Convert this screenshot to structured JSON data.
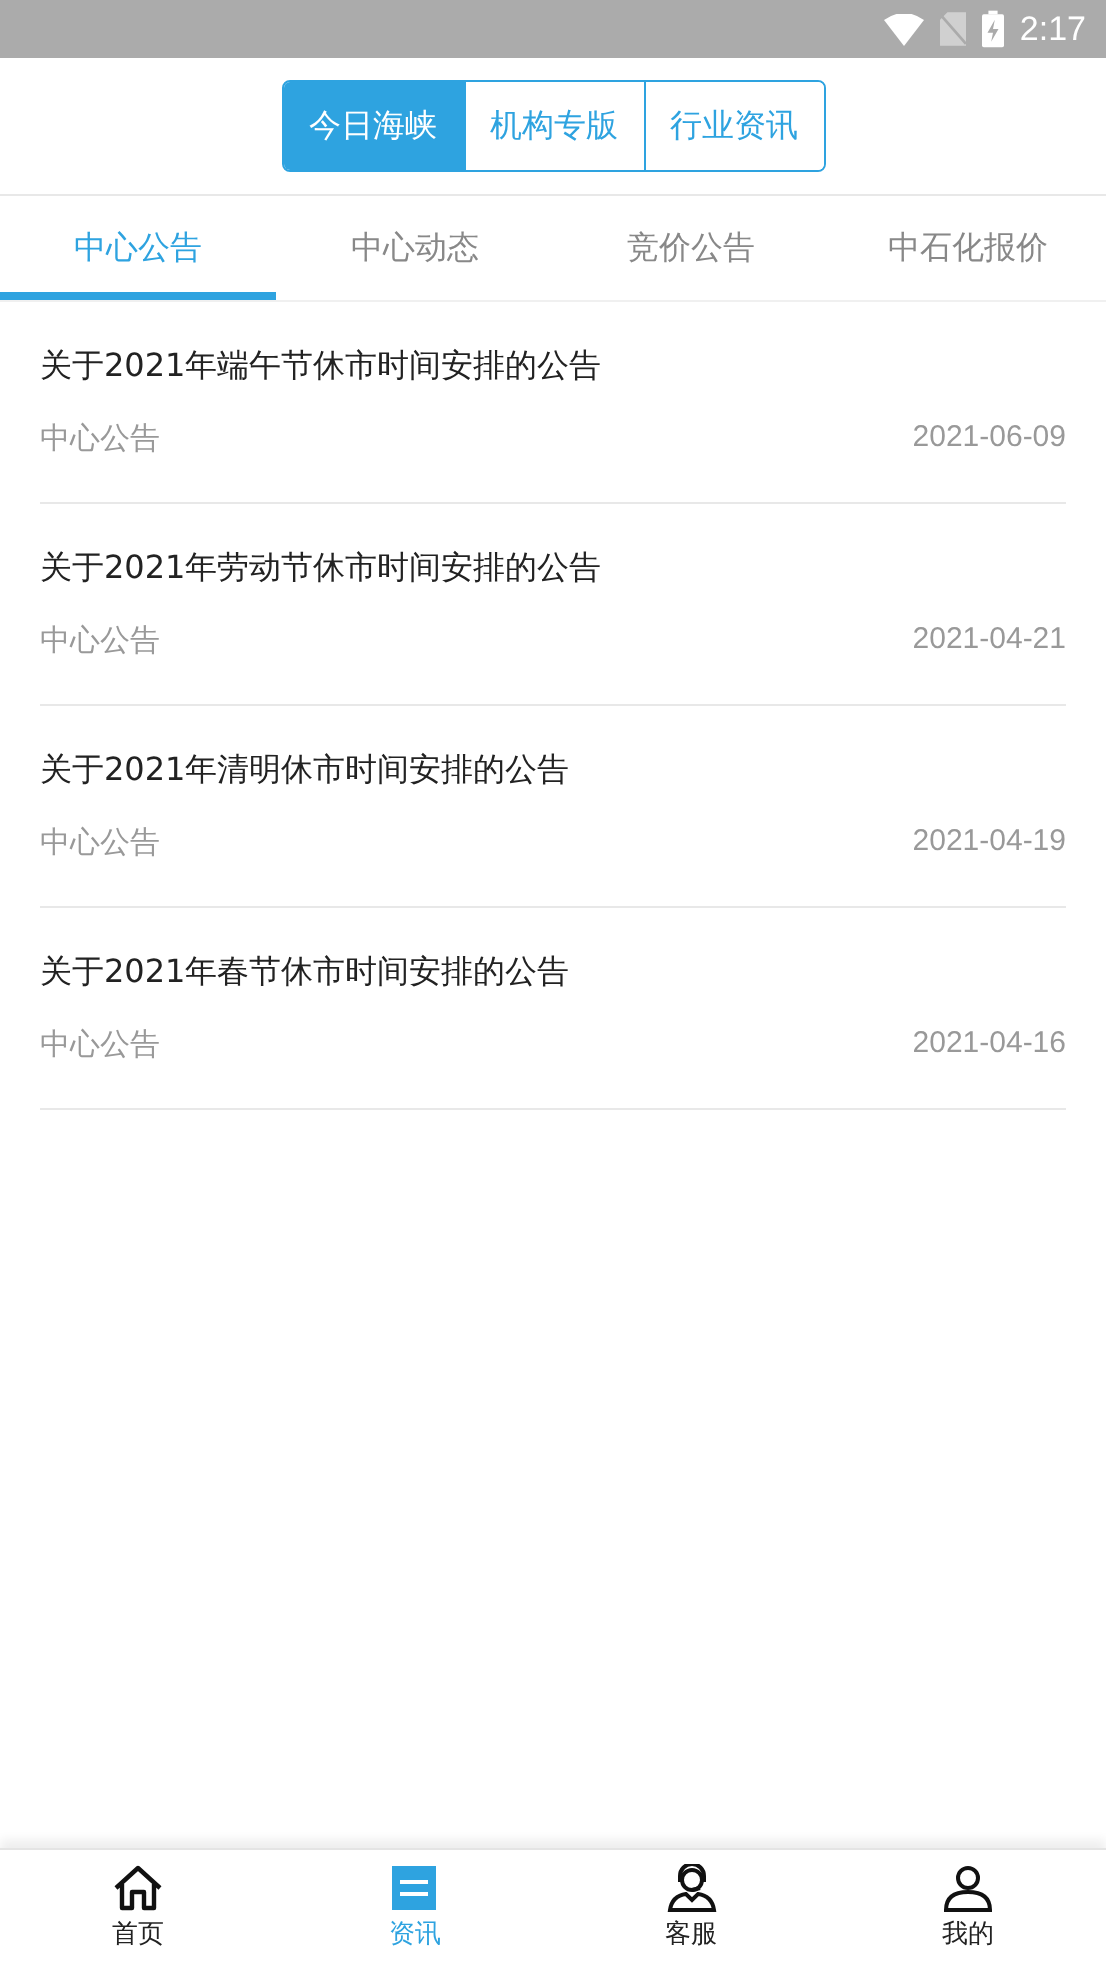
{
  "status_bar": {
    "time": "2:17"
  },
  "segments": [
    {
      "label": "今日海峡",
      "selected": true
    },
    {
      "label": "机构专版",
      "selected": false
    },
    {
      "label": "行业资讯",
      "selected": false
    }
  ],
  "tabs": [
    {
      "label": "中心公告",
      "selected": true
    },
    {
      "label": "中心动态",
      "selected": false
    },
    {
      "label": "竞价公告",
      "selected": false
    },
    {
      "label": "中石化报价",
      "selected": false
    }
  ],
  "articles": [
    {
      "title": "关于2021年端午节休市时间安排的公告",
      "category": "中心公告",
      "date": "2021-06-09"
    },
    {
      "title": "关于2021年劳动节休市时间安排的公告",
      "category": "中心公告",
      "date": "2021-04-21"
    },
    {
      "title": "关于2021年清明休市时间安排的公告",
      "category": "中心公告",
      "date": "2021-04-19"
    },
    {
      "title": "关于2021年春节休市时间安排的公告",
      "category": "中心公告",
      "date": "2021-04-16"
    }
  ],
  "bottom_nav": [
    {
      "kind": "home",
      "label": "首页",
      "selected": false
    },
    {
      "kind": "news",
      "label": "资讯",
      "selected": true
    },
    {
      "kind": "service",
      "label": "客服",
      "selected": false
    },
    {
      "kind": "user",
      "label": "我的",
      "selected": false
    }
  ]
}
